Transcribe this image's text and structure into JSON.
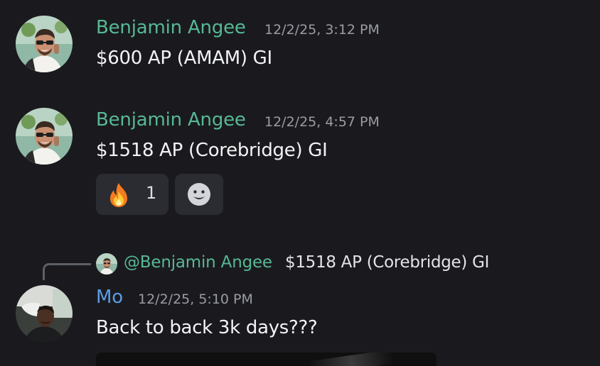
{
  "messages": [
    {
      "author": "Benjamin Angee",
      "timestamp": "12/2/25, 3:12 PM",
      "content": "$600 AP (AMAM) GI"
    },
    {
      "author": "Benjamin Angee",
      "timestamp": "12/2/25, 4:57 PM",
      "content": "$1518 AP (Corebridge) GI",
      "reactions": [
        {
          "emoji": "fire-emoji",
          "count": "1"
        }
      ],
      "add_reaction_icon": "smiley-icon"
    },
    {
      "author": "Mo",
      "timestamp": "12/2/25, 5:10 PM",
      "content": "Back to back 3k days???",
      "reply": {
        "mention": "@Benjamin Angee",
        "text": "$1518 AP (Corebridge) GI"
      },
      "attachment": "image"
    }
  ],
  "colors": {
    "background": "#1a1a1e",
    "author_ben": "#57b894",
    "author_mo": "#5b9be6",
    "timestamp": "#9a9ca4",
    "reaction_bg": "#2b2c31"
  }
}
